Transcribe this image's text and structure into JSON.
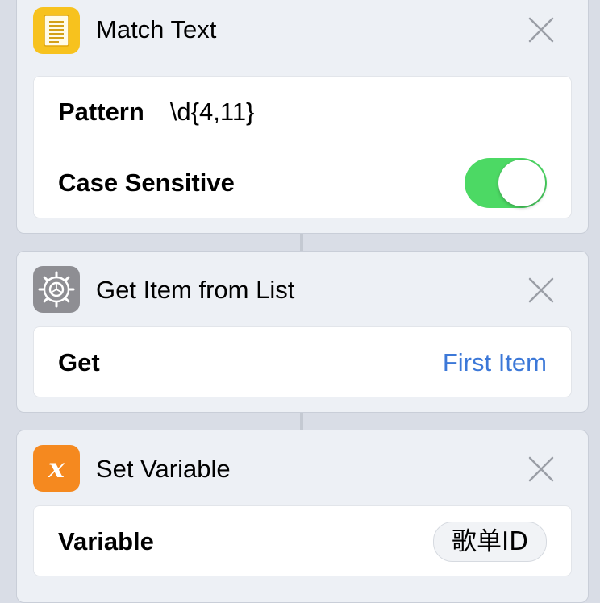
{
  "actions": [
    {
      "title": "Match Text",
      "icon": "document-icon",
      "icon_color": "#f7c21e",
      "pattern_label": "Pattern",
      "pattern_value": "\\d{4,11}",
      "case_label": "Case Sensitive",
      "case_sensitive": true
    },
    {
      "title": "Get Item from List",
      "icon": "gear-icon",
      "icon_color": "#8e8e93",
      "get_label": "Get",
      "get_value": "First Item"
    },
    {
      "title": "Set Variable",
      "icon": "variable-x-icon",
      "icon_color": "#f5891f",
      "variable_label": "Variable",
      "variable_value": "歌单ID"
    }
  ],
  "colors": {
    "toggle_on": "#4cd964",
    "link": "#3c78d8",
    "close": "#9a9ea6"
  }
}
